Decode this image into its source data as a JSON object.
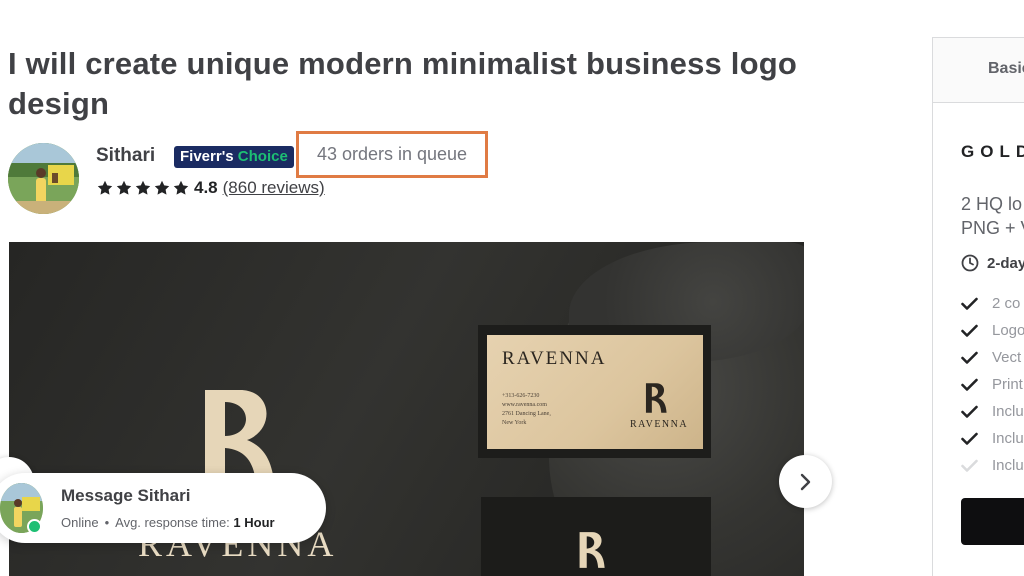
{
  "breadcrumb": {
    "text": "· ·  ·  · ·  ·  ·"
  },
  "gig": {
    "title": "I will create unique modern minimalist business logo design"
  },
  "seller": {
    "name": "Sithari",
    "badge_part1": "Fiverr's",
    "badge_part2": "Choice",
    "queue": "43 orders in queue",
    "rating": "4.8",
    "reviews": "(860 reviews)",
    "stars": 5
  },
  "gallery": {
    "card_brand_big": "RAVENNA",
    "card_title": "RAVENNA",
    "card_brand_small": "RAVENNA",
    "card_lines": [
      "+313-626-7230",
      "www.ravenna.com",
      "2761 Dancing Lane,",
      "New York"
    ],
    "bottom_brand": "RAVENNA",
    "monogram": "R"
  },
  "message": {
    "title": "Message Sithari",
    "status": "Online",
    "response_label": "Avg. response time:",
    "response_value": "1 Hour"
  },
  "package_panel": {
    "tab_label": "Basic",
    "package_name": "GOLD",
    "description_line1": "2 HQ lo",
    "description_line2": "PNG + V",
    "delivery": "2-day",
    "features": [
      {
        "label": "2 co",
        "included": true
      },
      {
        "label": "Logo",
        "included": true
      },
      {
        "label": "Vect",
        "included": true
      },
      {
        "label": "Print",
        "included": true
      },
      {
        "label": "Inclu",
        "included": true
      },
      {
        "label": "Inclu",
        "included": true
      },
      {
        "label": "Inclu",
        "included": false
      }
    ]
  },
  "colors": {
    "highlight_border": "#e07b44",
    "badge_bg": "#1a2b62",
    "online_green": "#1dbf73"
  }
}
